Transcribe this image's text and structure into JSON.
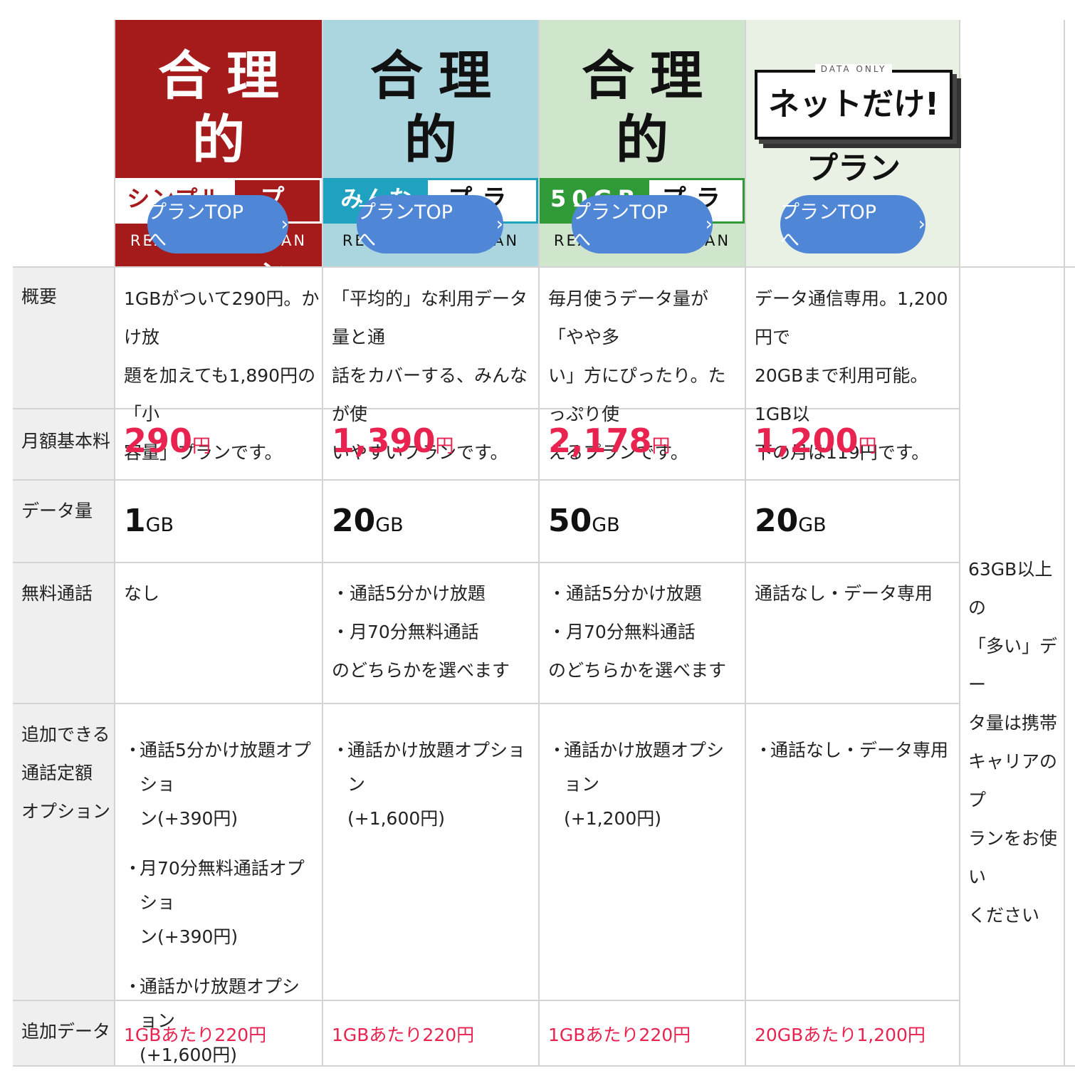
{
  "colors": {
    "simple": "#a51a1a",
    "minna": "#acd6df",
    "gb50": "#cfe5cc",
    "accent": "#e8234f",
    "button": "#4f86d6"
  },
  "plans": [
    {
      "logo_title": "合理的",
      "badge_left": "シンプル290",
      "badge_right": "プラン",
      "subtitle": "REASONABLE PLAN",
      "button": "プランTOPへ",
      "chevron": "›",
      "summary": "1GBがついて290円。かけ放\n題を加えても1,890円の「小\n容量」プランです。",
      "price_value": "290",
      "price_unit": "円",
      "data_value": "1",
      "data_unit": "GB",
      "free_call": "なし",
      "options": [
        "通話5分かけ放題オプショ\nン(+390円)",
        "月70分無料通話オプショ\nン(+390円)",
        "通話かけ放題オプション\n(+1,600円)"
      ],
      "extra_data": "1GBあたり220円"
    },
    {
      "logo_title": "合理的",
      "badge_left": "みんなの",
      "badge_right": "プラン",
      "subtitle": "REASONABLE PLAN",
      "button": "プランTOPへ",
      "chevron": "›",
      "summary": "「平均的」な利用データ量と通\n話をカバーする、みんなが使\nいやすいプランです。",
      "price_value": "1,390",
      "price_unit": "円",
      "data_value": "20",
      "data_unit": "GB",
      "free_call": "・通話5分かけ放題\n・月70分無料通話\nのどちらかを選べます",
      "options": [
        "通話かけ放題オプション\n(+1,600円)"
      ],
      "extra_data": "1GBあたり220円"
    },
    {
      "logo_title": "合理的",
      "badge_left": "50GB",
      "badge_right": "プラン",
      "subtitle": "REASONABLE PLAN",
      "button": "プランTOPへ",
      "chevron": "›",
      "summary": "毎月使うデータ量が「やや多\nい」方にぴったり。たっぷり使\nえるプランです。",
      "price_value": "2,178",
      "price_unit": "円",
      "data_value": "50",
      "data_unit": "GB",
      "free_call": "・通話5分かけ放題\n・月70分無料通話\nのどちらかを選べます",
      "options": [
        "通話かけ放題オプション\n(+1,200円)"
      ],
      "extra_data": "1GBあたり220円"
    },
    {
      "logo_tag": "DATA ONLY",
      "logo_name": "ネットだけ!プラン",
      "button": "プランTOPへ",
      "chevron": "›",
      "summary": "データ通信専用。1,200円で\n20GBまで利用可能。1GB以\n下の月は119円です。",
      "price_value": "1,200",
      "price_unit": "円",
      "data_value": "20",
      "data_unit": "GB",
      "free_call": "通話なし・データ専用",
      "options": [
        "通話なし・データ専用"
      ],
      "extra_data": "20GBあたり1,200円"
    }
  ],
  "row_labels": {
    "summary": "概要",
    "price": "月額基本料",
    "data": "データ量",
    "free_call": "無料通話",
    "options": "追加できる\n通話定額\nオプション",
    "extra_data": "追加データ"
  },
  "carrier_note": "63GB以上の\n「多い」デー\nタ量は携帯\nキャリアのプ\nランをお使い\nください",
  "bullet": "・"
}
